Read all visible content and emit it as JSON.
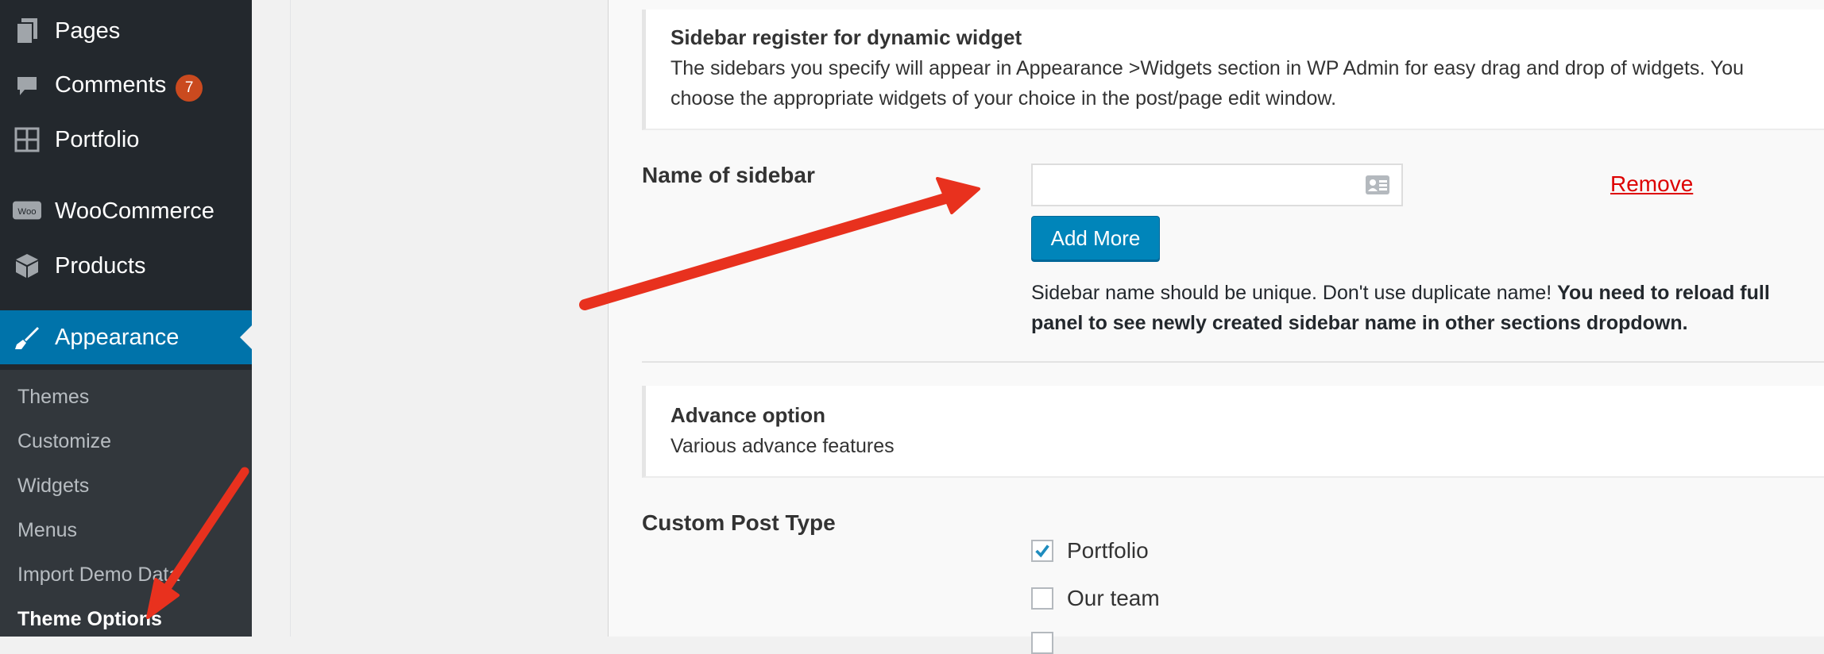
{
  "sidebar": {
    "items": [
      {
        "label": "Pages",
        "icon": "pages-icon"
      },
      {
        "label": "Comments",
        "icon": "comments-icon",
        "badge": "7"
      },
      {
        "label": "Portfolio",
        "icon": "portfolio-grid-icon"
      },
      {
        "label": "WooCommerce",
        "icon": "woocommerce-icon"
      },
      {
        "label": "Products",
        "icon": "products-box-icon"
      },
      {
        "label": "Appearance",
        "icon": "paintbrush-icon",
        "current": true
      }
    ],
    "submenu": [
      {
        "label": "Themes"
      },
      {
        "label": "Customize"
      },
      {
        "label": "Widgets"
      },
      {
        "label": "Menus"
      },
      {
        "label": "Import Demo Data"
      },
      {
        "label": "Theme Options",
        "current": true
      }
    ],
    "woo_logo_text": "Woo"
  },
  "main": {
    "sidebar_section": {
      "title": "Sidebar register for dynamic widget",
      "desc_line1": "The sidebars you specify will appear in Appearance >Widgets section in WP Admin for easy drag and drop of widgets. You",
      "desc_line2": "choose the appropriate widgets of your choice in the post/page edit window."
    },
    "name_of_sidebar": {
      "label": "Name of sidebar",
      "input_value": "",
      "remove_label": "Remove",
      "add_more_label": "Add More",
      "note_plain": "Sidebar name should be unique. Don't use duplicate name! ",
      "note_bold_1": "You need to reload full",
      "note_bold_2": "panel to see newly created sidebar name in other sections dropdown."
    },
    "advance_section": {
      "title": "Advance option",
      "desc": "Various advance features"
    },
    "custom_post_type": {
      "label": "Custom Post Type",
      "options": [
        {
          "label": "Portfolio",
          "checked": true
        },
        {
          "label": "Our team",
          "checked": false
        }
      ]
    }
  },
  "colors": {
    "sidebar_bg": "#23282d",
    "current_bg": "#0073aa",
    "button_bg": "#0085ba",
    "arrow": "#e8311e",
    "remove_link": "#dd0000"
  }
}
